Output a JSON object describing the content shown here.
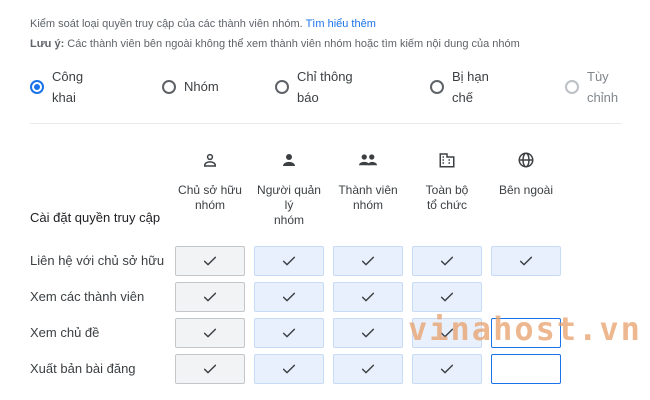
{
  "intro": {
    "line1_text": "Kiểm soát loại quyền truy cập của các thành viên nhóm. ",
    "learn_more": "Tìm hiểu thêm",
    "note_label": "Lưu ý:",
    "note_text": " Các thành viên bên ngoài không thể xem thành viên nhóm hoặc tìm kiếm nội dung của nhóm"
  },
  "access_types": [
    {
      "label": "Công\nkhai",
      "selected": true
    },
    {
      "label": "Nhóm",
      "selected": false
    },
    {
      "label": "Chỉ thông\nbáo",
      "selected": false
    },
    {
      "label": "Bị hạn\nchế",
      "selected": false
    },
    {
      "label": "Tùy\nchỉnh",
      "selected": false,
      "disabled": true
    }
  ],
  "columns": [
    {
      "label": "Chủ sở hữu\nnhóm",
      "icon": "person-outline-icon"
    },
    {
      "label": "Người quản\nlý\nnhóm",
      "icon": "person-filled-icon"
    },
    {
      "label": "Thành viên\nnhóm",
      "icon": "people-icon"
    },
    {
      "label": "Toàn bộ\ntổ chức",
      "icon": "building-icon"
    },
    {
      "label": "Bên ngoài",
      "icon": "globe-icon"
    }
  ],
  "section_title": "Cài đặt quyền truy cập",
  "rows": [
    {
      "label": "Liên hệ với chủ sở hữu",
      "cells": [
        "check",
        "check",
        "check",
        "check",
        "check"
      ]
    },
    {
      "label": "Xem các thành viên",
      "cells": [
        "check",
        "check",
        "check",
        "check",
        "blank"
      ]
    },
    {
      "label": "Xem chủ đề",
      "cells": [
        "check",
        "check",
        "check",
        "check",
        "empty"
      ]
    },
    {
      "label": "Xuất bản bài đăng",
      "cells": [
        "check",
        "check",
        "check",
        "check",
        "empty"
      ]
    }
  ],
  "watermark": "vinahost.vn",
  "colors": {
    "accent": "#1a73e8",
    "cell_fill": "#e8f0fe",
    "owner_fill": "#f1f3f4",
    "watermark": "#e8a06b"
  }
}
